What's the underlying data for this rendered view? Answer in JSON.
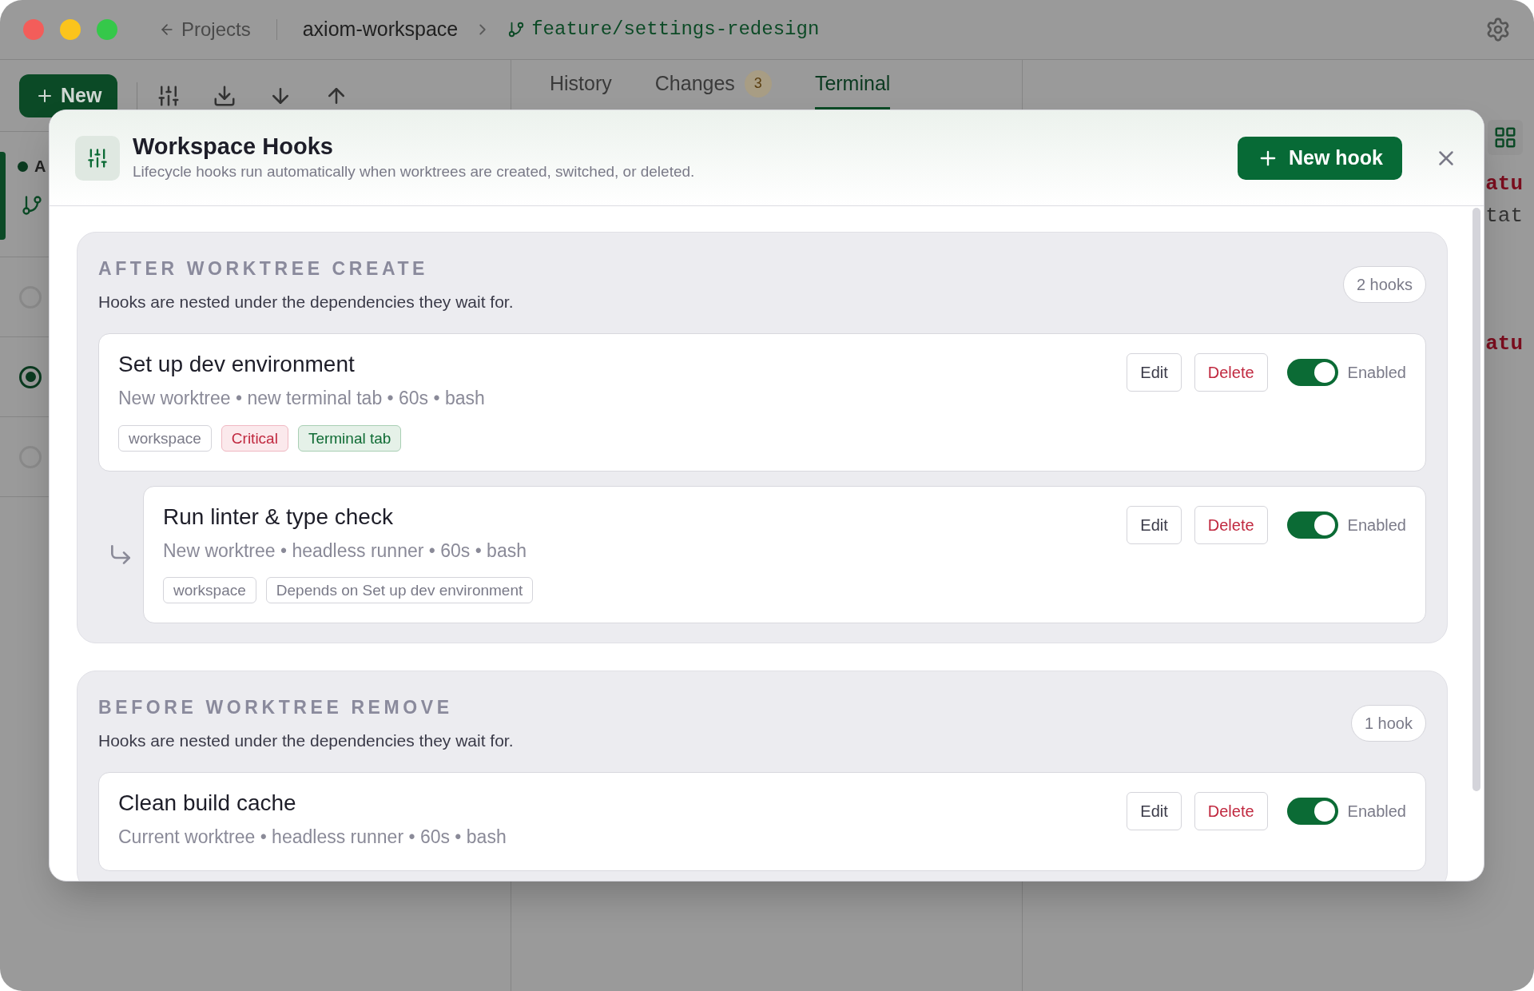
{
  "topbar": {
    "back_link": "Projects",
    "workspace": "axiom-workspace",
    "branch": "feature/settings-redesign"
  },
  "toolbar": {
    "new_button": "New"
  },
  "tabs": [
    {
      "label": "History",
      "selected": false
    },
    {
      "label": "Changes",
      "badge": "3",
      "selected": false
    },
    {
      "label": "Terminal",
      "selected": true
    }
  ],
  "worktrees": [
    {
      "kind": "current",
      "label": "A",
      "selected": true
    },
    {
      "kind": "radio",
      "checked": false
    },
    {
      "kind": "radio",
      "checked": true
    },
    {
      "kind": "radio",
      "checked": false
    }
  ],
  "terminal": {
    "lines": [
      {
        "text": "atu",
        "kind": "keyword"
      },
      {
        "text": "tat",
        "kind": "plain"
      },
      {
        "text": "atu",
        "kind": "keyword"
      }
    ]
  },
  "dialog": {
    "title": "Workspace Hooks",
    "subtitle": "Lifecycle hooks run automatically when worktrees are created, switched, or deleted.",
    "new_button": "New hook",
    "groups": [
      {
        "title": "AFTER WORKTREE CREATE",
        "description": "Hooks are nested under the dependencies they wait for.",
        "count": "2 hooks",
        "hooks": [
          {
            "name": "Set up dev environment",
            "meta": "New worktree • new terminal tab • 60s • bash",
            "actions": [
              "Edit",
              "Delete"
            ],
            "enabled": true,
            "status": "Enabled",
            "tags": [
              {
                "label": "workspace",
                "kind": "plain"
              },
              {
                "label": "Critical",
                "kind": "danger"
              },
              {
                "label": "Terminal tab",
                "kind": "success"
              }
            ],
            "children": [
              {
                "name": "Run linter & type check",
                "meta": "New worktree • headless runner • 60s • bash",
                "actions": [
                  "Edit",
                  "Delete"
                ],
                "enabled": true,
                "status": "Enabled",
                "tags": [
                  {
                    "label": "workspace",
                    "kind": "plain"
                  },
                  {
                    "label": "Depends on Set up dev environment",
                    "kind": "plain"
                  }
                ]
              }
            ]
          }
        ]
      },
      {
        "title": "BEFORE WORKTREE REMOVE",
        "description": "Hooks are nested under the dependencies they wait for.",
        "count": "1 hook",
        "hooks": [
          {
            "name": "Clean build cache",
            "meta": "Current worktree • headless runner • 60s • bash",
            "actions": [
              "Edit",
              "Delete"
            ],
            "enabled": true,
            "status": "Enabled"
          }
        ]
      }
    ]
  }
}
